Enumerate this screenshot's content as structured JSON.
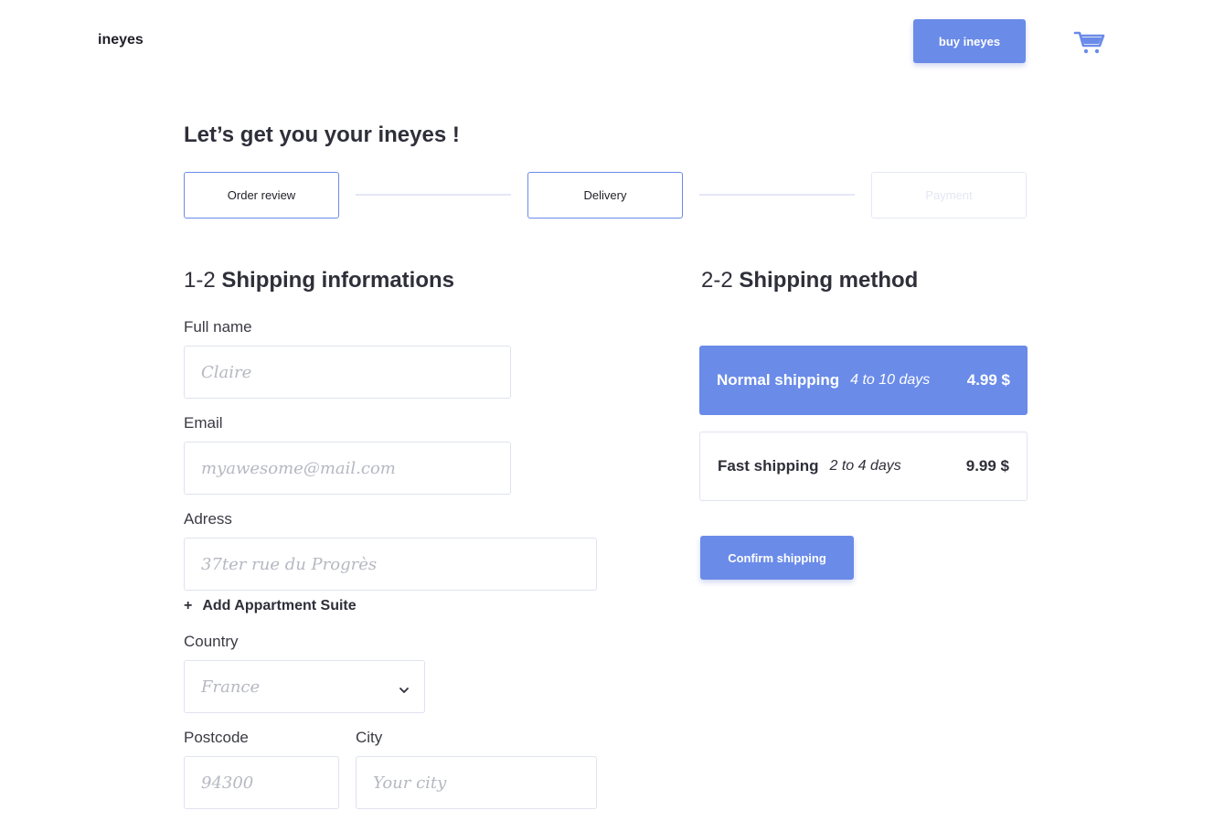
{
  "header": {
    "logo": "ineyes",
    "buy_label": "buy ineyes",
    "cart_icon": "cart-icon"
  },
  "page_title": "Let’s get you your ineyes !",
  "steps": [
    {
      "label": "Order review",
      "state": "done"
    },
    {
      "label": "Delivery",
      "state": "active"
    },
    {
      "label": "Payment",
      "state": "inactive"
    }
  ],
  "shipping_info": {
    "num": "1-2",
    "title": "Shipping informations",
    "full_name": {
      "label": "Full name",
      "placeholder": "Claire"
    },
    "email": {
      "label": "Email",
      "placeholder": "myawesome@mail.com"
    },
    "address": {
      "label": "Adress",
      "placeholder": "37ter rue du Progrès"
    },
    "add_suite": {
      "icon": "+",
      "label": "Add Appartment Suite"
    },
    "country": {
      "label": "Country",
      "value": "France"
    },
    "postcode": {
      "label": "Postcode",
      "placeholder": "94300"
    },
    "city": {
      "label": "City",
      "placeholder": "Your city"
    }
  },
  "shipping_method": {
    "num": "2-2",
    "title": "Shipping method",
    "options": [
      {
        "name": "Normal shipping",
        "days": "4 to 10 days",
        "price": "4.99 $",
        "selected": true
      },
      {
        "name": "Fast shipping",
        "days": "2 to 4 days",
        "price": "9.99 $",
        "selected": false
      }
    ],
    "confirm_label": "Confirm shipping"
  },
  "colors": {
    "accent": "#6a8be8",
    "border": "#dfe3ee",
    "text": "#2f2f3a"
  }
}
